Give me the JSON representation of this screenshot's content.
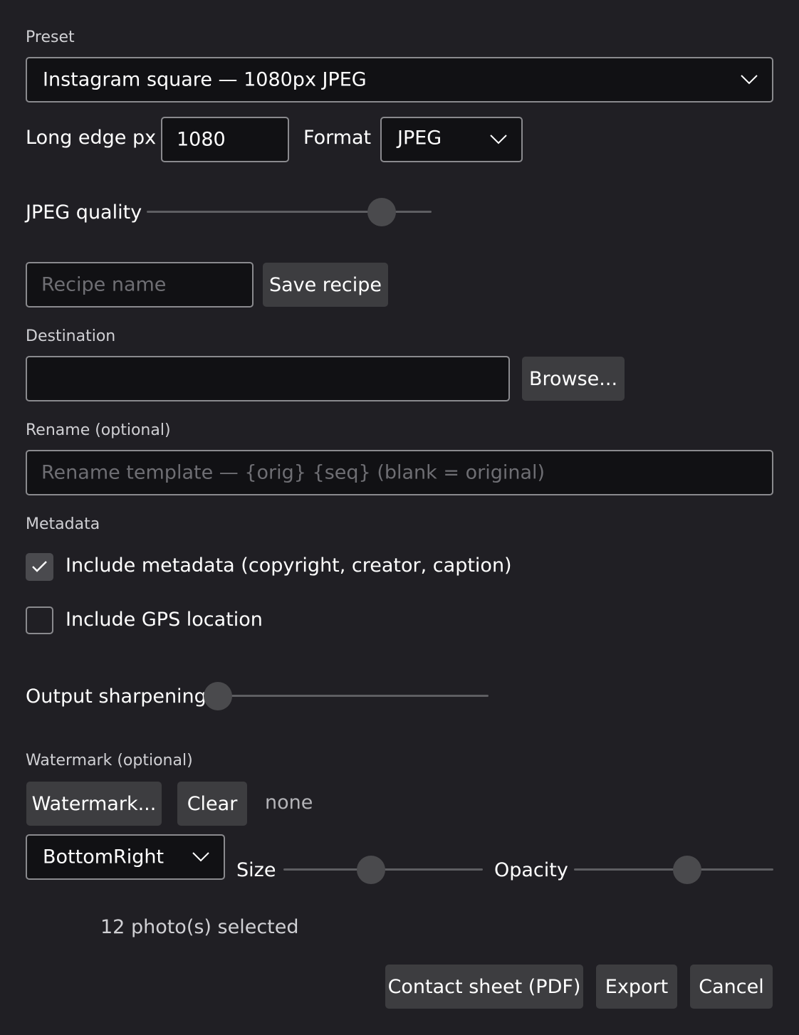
{
  "preset": {
    "label": "Preset",
    "value": "Instagram square — 1080px JPEG",
    "chevron_icon": "chevron-down-icon"
  },
  "size": {
    "long_edge_label": "Long edge px",
    "long_edge_value": "1080",
    "format_label": "Format",
    "format_value": "JPEG"
  },
  "quality": {
    "label": "JPEG quality",
    "slider_fraction": 0.86
  },
  "recipe": {
    "placeholder": "Recipe name",
    "save_label": "Save recipe"
  },
  "destination": {
    "label": "Destination",
    "value": "",
    "browse_label": "Browse..."
  },
  "rename": {
    "label": "Rename (optional)",
    "placeholder": "Rename template — {orig} {seq} (blank = original)"
  },
  "metadata": {
    "label": "Metadata",
    "include_metadata_label": "Include metadata (copyright, creator, caption)",
    "include_metadata_checked": true,
    "include_gps_label": "Include GPS location",
    "include_gps_checked": false
  },
  "sharpening": {
    "label": "Output sharpening",
    "slider_fraction": 0.0
  },
  "watermark": {
    "label": "Watermark (optional)",
    "choose_label": "Watermark...",
    "clear_label": "Clear",
    "status": "none",
    "position_value": "BottomRight",
    "size_label": "Size",
    "size_fraction": 0.43,
    "opacity_label": "Opacity",
    "opacity_fraction": 0.58
  },
  "footer": {
    "selection_status": "12 photo(s) selected",
    "contact_sheet_label": "Contact sheet (PDF)",
    "export_label": "Export",
    "cancel_label": "Cancel"
  },
  "colors": {
    "background": "#201f24",
    "field_background": "#111114",
    "field_border": "#8a8a8e",
    "button_background": "#3d3d40",
    "slider_track": "#5e5e62",
    "slider_thumb": "#4a4a4d"
  }
}
